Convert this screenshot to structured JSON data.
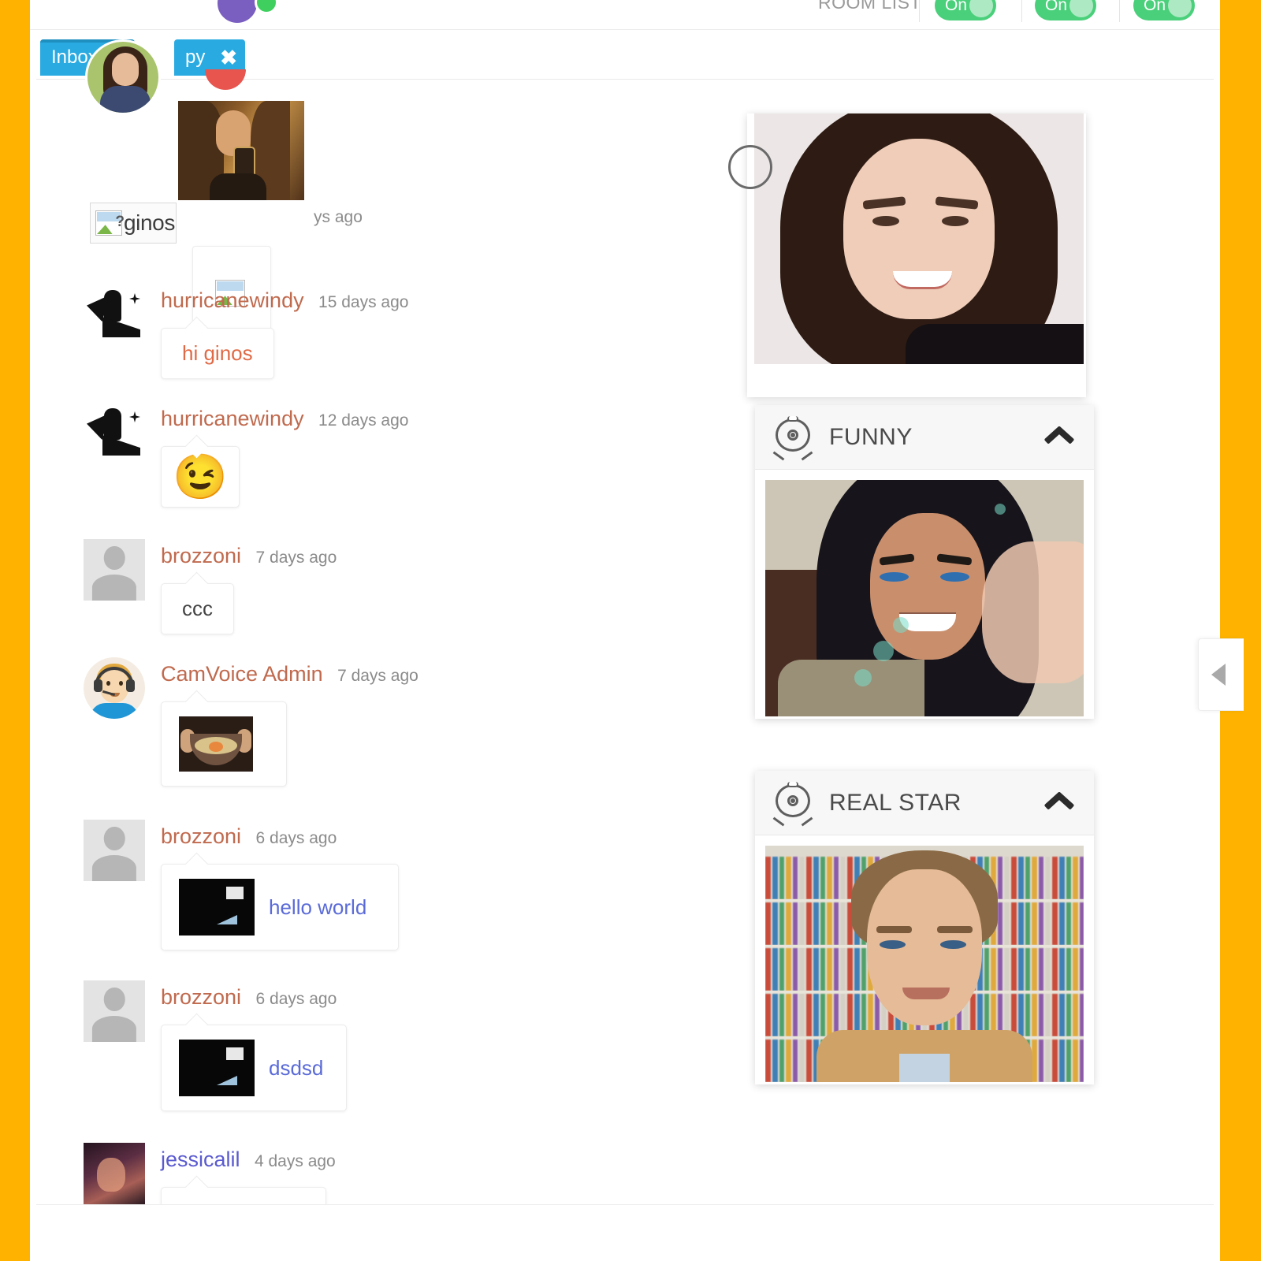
{
  "theme": {
    "frame_color": "#FFB300",
    "tab_color": "#29ABE2",
    "toggle_on_color": "#4AD07A",
    "author_color": "#C06A4E",
    "link_color": "#5A6BD8"
  },
  "topbar": {
    "room_list_label": "ROOM LIST",
    "toggles": [
      {
        "label": "On",
        "state": "on"
      },
      {
        "label": "On",
        "state": "on"
      },
      {
        "label": "On",
        "state": "on"
      }
    ]
  },
  "tabs": [
    {
      "id": "inbox",
      "label": "Inbox",
      "active": true,
      "closable": false
    },
    {
      "id": "history",
      "label": "py",
      "active": false,
      "closable": true,
      "close_glyph": "✖"
    }
  ],
  "chat": {
    "pinned": {
      "broken_image_label": "ginos",
      "time": "ys ago"
    },
    "messages": [
      {
        "author": "hurricanewindy",
        "time": "15 days ago",
        "avatar": "fairy-silhouette-avatar",
        "type": "text",
        "text": "hi ginos",
        "text_style": "orange"
      },
      {
        "author": "hurricanewindy",
        "time": "12 days ago",
        "avatar": "fairy-silhouette-avatar",
        "type": "emoji",
        "emoji": "😉"
      },
      {
        "author": "brozzoni",
        "time": "7 days ago",
        "avatar": "default-person-avatar",
        "type": "text",
        "text": "ccc",
        "text_style": "plain"
      },
      {
        "author": "CamVoice Admin",
        "time": "7 days ago",
        "avatar": "admin-headset-avatar",
        "type": "image",
        "image_alt": "food-bowl-thumbnail"
      },
      {
        "author": "brozzoni",
        "time": "6 days ago",
        "avatar": "default-person-avatar",
        "type": "link",
        "link_text": "hello world",
        "thumb_alt": "dark-video-thumbnail"
      },
      {
        "author": "brozzoni",
        "time": "6 days ago",
        "avatar": "default-person-avatar",
        "type": "link",
        "link_text": "dsdsd",
        "thumb_alt": "dark-video-thumbnail"
      },
      {
        "author": "jessicalil",
        "time": "4 days ago",
        "avatar": "photo-avatar",
        "author_style": "blue",
        "type": "none"
      }
    ]
  },
  "cam_panels": [
    {
      "id": "top",
      "title": "",
      "has_header": false,
      "stream_alt": "brunette-woman-webcam",
      "collapse_glyph": "⌃"
    },
    {
      "id": "funny",
      "title": "FUNNY",
      "has_header": true,
      "stream_alt": "woman-waving-webcam",
      "collapse_glyph": "⌃"
    },
    {
      "id": "realstar",
      "title": "REAL STAR",
      "has_header": true,
      "stream_alt": "man-bookshelf-webcam",
      "collapse_glyph": "⌃"
    }
  ],
  "right_handle": {
    "label": "collapse-panel",
    "glyph": "◀"
  }
}
